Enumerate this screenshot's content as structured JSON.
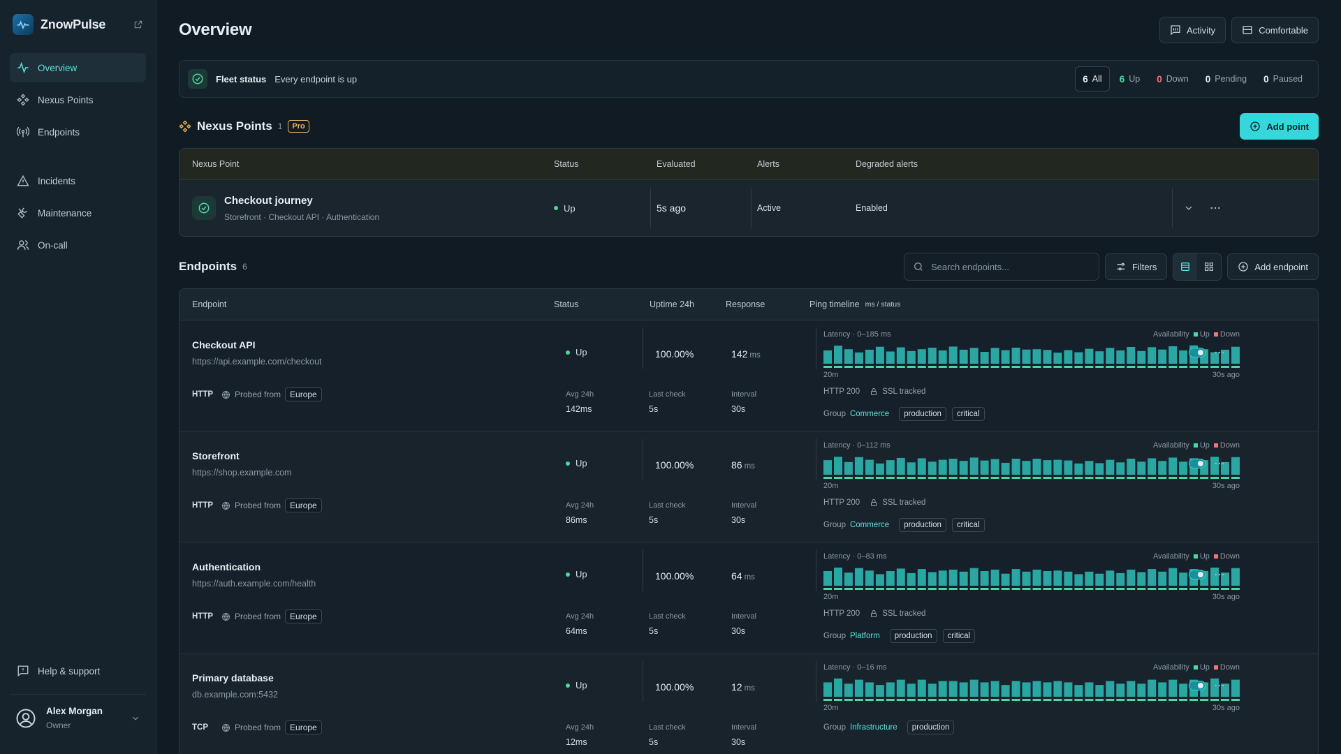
{
  "app": {
    "name": "ZnowPulse"
  },
  "nav": {
    "overview": "Overview",
    "nexus": "Nexus Points",
    "endpoints": "Endpoints",
    "incidents": "Incidents",
    "maintenance": "Maintenance",
    "oncall": "On-call",
    "help": "Help & support"
  },
  "user": {
    "name": "Alex Morgan",
    "role": "Owner"
  },
  "header": {
    "title": "Overview",
    "activity": "Activity",
    "density": "Comfortable"
  },
  "fleet": {
    "label": "Fleet status",
    "message": "Every endpoint is up",
    "counts": [
      {
        "n": "6",
        "label": "All"
      },
      {
        "n": "6",
        "label": "Up"
      },
      {
        "n": "0",
        "label": "Down"
      },
      {
        "n": "0",
        "label": "Pending"
      },
      {
        "n": "0",
        "label": "Paused"
      }
    ]
  },
  "nexus": {
    "title": "Nexus Points",
    "count": "1",
    "badge": "Pro",
    "add": "Add point",
    "columns": [
      "Nexus Point",
      "Status",
      "Evaluated",
      "Alerts",
      "Degraded alerts"
    ],
    "row": {
      "name": "Checkout journey",
      "sub": "Storefront · Checkout API · Authentication",
      "status": "Up",
      "evaluated": "5s ago",
      "alerts": "Active",
      "degraded": "Enabled"
    }
  },
  "endpoints": {
    "title": "Endpoints",
    "count": "6",
    "search_placeholder": "Search endpoints...",
    "filters": "Filters",
    "add": "Add endpoint",
    "columns": {
      "endpoint": "Endpoint",
      "status": "Status",
      "uptime": "Uptime 24h",
      "response": "Response",
      "timeline": "Ping timeline",
      "timeline_unit": "ms / status"
    },
    "labels": {
      "probed": "Probed from",
      "avg": "Avg 24h",
      "last": "Last check",
      "interval": "Interval",
      "availability": "Availability",
      "up": "Up",
      "down": "Down",
      "start": "20m",
      "end": "30s ago",
      "group": "Group"
    },
    "colors": {
      "bar": "#2aa6a3",
      "up": "#4fd6a4",
      "down": "#f17676"
    },
    "rows": [
      {
        "name": "Checkout API",
        "url": "https://api.example.com/checkout",
        "proto": "HTTP",
        "region": "Europe",
        "status": "Up",
        "uptime": "100.00%",
        "response": "142",
        "response_unit": "ms",
        "avg": "142ms",
        "last": "5s",
        "interval": "30s",
        "latency": "Latency · 0–185 ms",
        "max": 185,
        "code": "HTTP 200",
        "ssl": "SSL tracked",
        "group": "Commerce",
        "tags": [
          "production",
          "critical"
        ],
        "pings": [
          98,
          130,
          104,
          132,
          110,
          140,
          118,
          148,
          112,
          146,
          125,
          155,
          118,
          160,
          128,
          100,
          124,
          150,
          108,
          145,
          112,
          128,
          142,
          118,
          152,
          124,
          140,
          105,
          140,
          120,
          142,
          125,
          128,
          122,
          98,
          120,
          102,
          132,
          110,
          140,
          118,
          148,
          112,
          146,
          125,
          155,
          118,
          162,
          128,
          102,
          124,
          150,
          108,
          145,
          112,
          128,
          142,
          118,
          152,
          124,
          140,
          105,
          140,
          120,
          142,
          125,
          128,
          122,
          98,
          120,
          102,
          132,
          110,
          140,
          118,
          148,
          112,
          146,
          125,
          155,
          118,
          160,
          128,
          100,
          124,
          150,
          108,
          145,
          112,
          128,
          142,
          118,
          152,
          124,
          140,
          105,
          140,
          120,
          142,
          125,
          128,
          122,
          98,
          120,
          102,
          132,
          110,
          140,
          118,
          148,
          112,
          146,
          125,
          155,
          118,
          162,
          128,
          102,
          124,
          150
        ]
      },
      {
        "name": "Storefront",
        "url": "https://shop.example.com",
        "proto": "HTTP",
        "region": "Europe",
        "status": "Up",
        "uptime": "100.00%",
        "response": "86",
        "response_unit": "ms",
        "avg": "86ms",
        "last": "5s",
        "interval": "30s",
        "latency": "Latency · 0–112 ms",
        "max": 112,
        "code": "HTTP 200",
        "ssl": "SSL tracked",
        "group": "Commerce",
        "tags": [
          "production",
          "critical"
        ],
        "pings": [
          62,
          80,
          64,
          86,
          70,
          88,
          74,
          92,
          70,
          88,
          78,
          96,
          68,
          94,
          80,
          60,
          78,
          90,
          66,
          88,
          70,
          80,
          86,
          74,
          92,
          76,
          84,
          64,
          86,
          74,
          86,
          78,
          80,
          76,
          60,
          74,
          62,
          80,
          66,
          86,
          70,
          88,
          74,
          92,
          70,
          88,
          78,
          96,
          68,
          94,
          80,
          60,
          78,
          90,
          66,
          88,
          70,
          80,
          86,
          74,
          92,
          76,
          84,
          64,
          86,
          74,
          86,
          78,
          80,
          76,
          60,
          74,
          62,
          80,
          66,
          86,
          70,
          88,
          74,
          92,
          70,
          88,
          78,
          96,
          68,
          94,
          80,
          60,
          78,
          90,
          66,
          88,
          70,
          80,
          86,
          74,
          92,
          76,
          84,
          64,
          86,
          74,
          86,
          78,
          80,
          76,
          60,
          74,
          62,
          80,
          66,
          86,
          70,
          88,
          74,
          92,
          70,
          88,
          78,
          96,
          68,
          94
        ]
      },
      {
        "name": "Authentication",
        "url": "https://auth.example.com/health",
        "proto": "HTTP",
        "region": "Europe",
        "status": "Up",
        "uptime": "100.00%",
        "response": "64",
        "response_unit": "ms",
        "avg": "64ms",
        "last": "5s",
        "interval": "30s",
        "latency": "Latency · 0–83 ms",
        "max": 83,
        "code": "HTTP 200",
        "ssl": "SSL tracked",
        "group": "Platform",
        "tags": [
          "production",
          "critical"
        ],
        "pings": [
          48,
          60,
          50,
          64,
          54,
          66,
          56,
          70,
          52,
          66,
          58,
          72,
          52,
          70,
          60,
          46,
          58,
          68,
          50,
          66,
          54,
          60,
          64,
          56,
          70,
          58,
          64,
          48,
          66,
          56,
          64,
          58,
          60,
          56,
          46,
          56,
          48,
          60,
          50,
          64,
          54,
          66,
          56,
          70,
          52,
          66,
          58,
          72,
          52,
          70,
          60,
          46,
          58,
          68,
          50,
          66,
          54,
          60,
          64,
          56,
          70,
          58,
          64,
          48,
          66,
          56,
          64,
          58,
          60,
          56,
          46,
          56,
          48,
          60,
          50,
          64,
          54,
          66,
          56,
          70,
          52,
          66,
          58,
          72,
          52,
          70,
          60,
          46,
          58,
          68,
          50,
          66,
          54,
          60,
          64,
          56,
          70,
          58,
          64,
          48,
          66,
          56,
          64,
          58,
          60,
          56,
          46,
          56,
          48,
          60,
          50,
          64,
          54,
          66,
          56,
          70,
          52,
          66,
          58,
          72,
          52,
          70
        ]
      },
      {
        "name": "Primary database",
        "url": "db.example.com:5432",
        "proto": "TCP",
        "region": "Europe",
        "status": "Up",
        "uptime": "100.00%",
        "response": "12",
        "response_unit": "ms",
        "avg": "12ms",
        "last": "5s",
        "interval": "30s",
        "latency": "Latency · 0–16 ms",
        "max": 16,
        "code": "",
        "ssl": "",
        "group": "Infrastructure",
        "tags": [
          "production"
        ],
        "pings": [
          9,
          12,
          10,
          12,
          10,
          13,
          11,
          13,
          10,
          13,
          11,
          14,
          10,
          13,
          11,
          9,
          11,
          13,
          10,
          13,
          10,
          12,
          12,
          11,
          13,
          11,
          12,
          9,
          12,
          11,
          12,
          11,
          12,
          11,
          9,
          11,
          9,
          12,
          10,
          12,
          10,
          13,
          11,
          13,
          10,
          13,
          11,
          14,
          10,
          13,
          11,
          9,
          11,
          13,
          10,
          13,
          10,
          12,
          12,
          11,
          13,
          11,
          12,
          9,
          12,
          11,
          12,
          11,
          12,
          11,
          9,
          11,
          9,
          12,
          10,
          12,
          10,
          13,
          11,
          13,
          10,
          13,
          11,
          14,
          10,
          13,
          11,
          9,
          11,
          13,
          10,
          13,
          10,
          12,
          12,
          11,
          13,
          11,
          12,
          9,
          12,
          11,
          12,
          11,
          12,
          11,
          9,
          11,
          9,
          12,
          10,
          12,
          10,
          13,
          11,
          13,
          10,
          13,
          11,
          14,
          10,
          13
        ]
      }
    ]
  }
}
